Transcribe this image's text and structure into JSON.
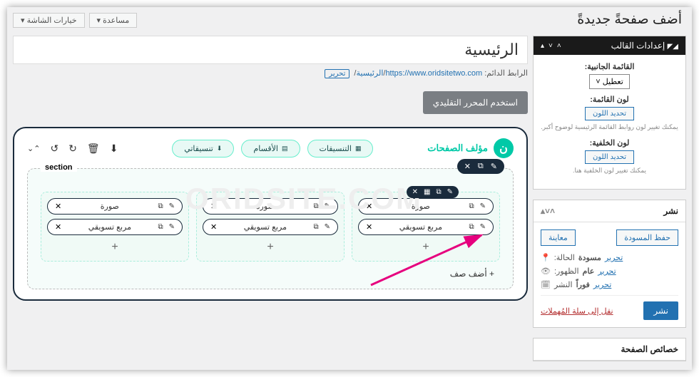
{
  "top": {
    "screen_opts": "خيارات الشاشة ▾",
    "help": "مساعدة ▾"
  },
  "heading": "أضف صفحةً جديدةً",
  "title_value": "الرئيسية",
  "permalink": {
    "label": "الرابط الدائم:",
    "url_base": "https://www.oridsitetwo.com",
    "slug": "الرئيسية",
    "edit": "تحرير"
  },
  "classic_btn": "استخدم المحرر التقليدي",
  "builder": {
    "title": "مؤلف الصفحات",
    "tabs": {
      "formats": "التنسيقات",
      "sections": "الأقسام",
      "coord": "تنسيقاتي"
    },
    "section_label": "section",
    "add_row": "+ أضف صف",
    "elem_image": "صورة",
    "elem_textbox": "مربع تسويقي"
  },
  "theme_panel": {
    "title": "إعدادات القالب",
    "sidebar_label": "القائمة الجانبية:",
    "sidebar_value": "تعطيل",
    "menu_color": "لون القائمة:",
    "color_btn": "تحديد اللون",
    "hint1": "يمكنك تغيير لون روابط القائمة الرئيسية لوضوح أكبر.",
    "bg_color": "لون الخلفية:",
    "hint2": "يمكنك تغيير لون الخلفية هنا."
  },
  "publish_panel": {
    "title": "نشر",
    "save_draft": "حفظ المسودة",
    "preview": "معاينة",
    "status_l": "الحالة:",
    "status_v": "مسودة",
    "edit": "تحرير",
    "vis_l": "الظهور:",
    "vis_v": "عام",
    "pub_l": "النشر",
    "pub_v": "فوراً",
    "trash": "نقل إلى سلة المُهملات",
    "publish": "نشر"
  },
  "attr_panel": {
    "title": "خصائص الصفحة"
  },
  "watermark": "ORIDSITE.COM"
}
